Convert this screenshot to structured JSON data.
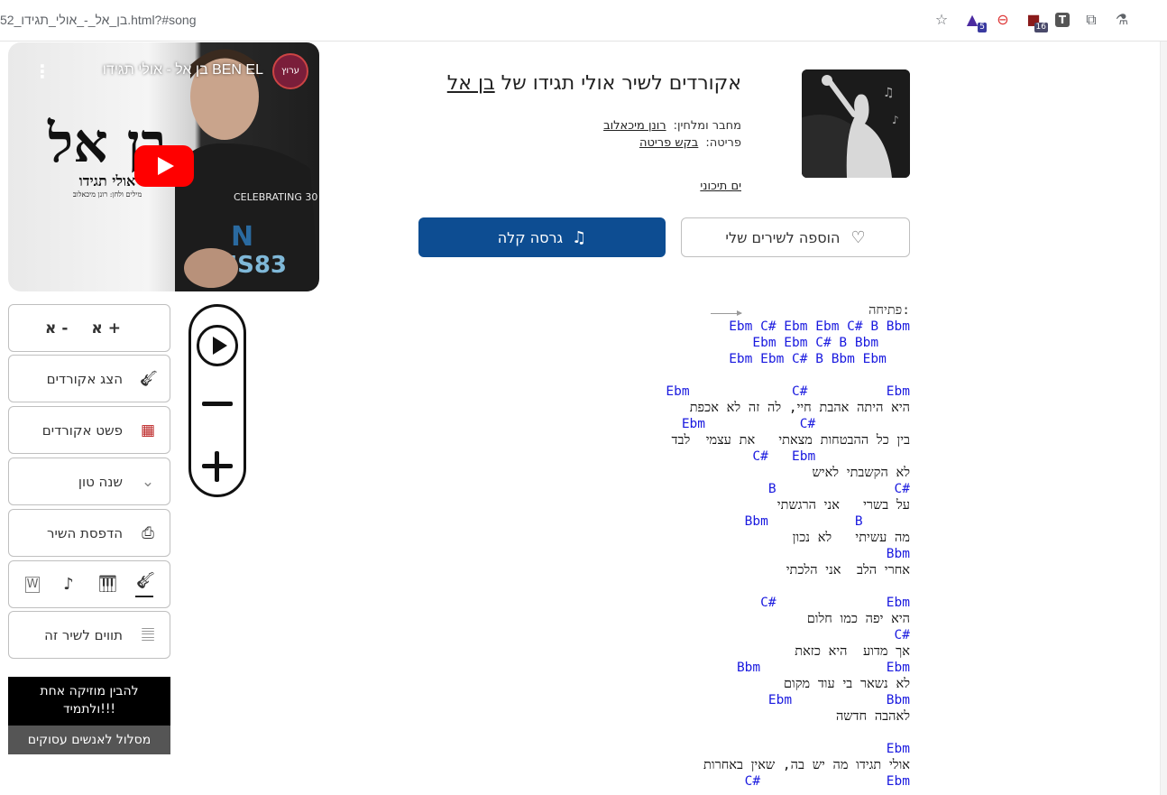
{
  "browser": {
    "url": "52_בן_אל_-_אולי_תגידו.html?#song",
    "extensions": [
      {
        "name": "graduation-cap-icon",
        "badge": "5"
      },
      {
        "name": "cookie-block-icon",
        "badge": ""
      },
      {
        "name": "store-icon",
        "badge": "16"
      },
      {
        "name": "t-square-icon",
        "badge": ""
      },
      {
        "name": "puzzle-icon",
        "badge": ""
      },
      {
        "name": "flask-icon",
        "badge": ""
      }
    ]
  },
  "video": {
    "title": "בן אל - אולי תגידו BEN EL",
    "logo_big": "בן אל",
    "logo_sub": "אולי תגידו",
    "logo_tiny": "מילים ולחן: רונן מיכאלוב",
    "channel": "ערוץ"
  },
  "song": {
    "title_prefix": "אקורדים לשיר אולי תגידו של",
    "artist": "בן אל",
    "composer_label": "מחבר ומלחין:",
    "composer": "רונן מיכאלוב",
    "strum_label": "פריטה:",
    "strum": "בקש פריטה",
    "tag": "ים תיכוני"
  },
  "actions": {
    "add_favorite": "הוספה לשירים שלי",
    "easy_version": "גרסה קלה"
  },
  "tools": {
    "font_plus": "א +",
    "font_minus": "א -",
    "show_chords": "הצג אקורדים",
    "simplify_chords": "פשט אקורדים",
    "change_key": "שנה טון",
    "print_song": "הדפסת השיר",
    "tags_for_song": "תווים לשיר זה"
  },
  "promo": {
    "line1": "להבין מוזיקה אחת",
    "line2": "ולתמיד!!!",
    "cta": "מסלול לאנשים עסוקים"
  },
  "sheet": {
    "intro_label": "פתיחה:",
    "lines": [
      {
        "t": "c",
        "v": "Ebm C# Ebm Ebm C# B Bbm"
      },
      {
        "t": "c",
        "v": "Ebm Ebm C# B Bbm    "
      },
      {
        "t": "c",
        "v": "Ebm Ebm C# B Bbm Ebm   "
      },
      {
        "t": "g",
        "v": ""
      },
      {
        "t": "c",
        "v": "Ebm             C#          Ebm"
      },
      {
        "t": "l",
        "v": "היא היתה אהבת חיי, לה זה לא אכפת"
      },
      {
        "t": "c",
        "v": "Ebm            C#            "
      },
      {
        "t": "l",
        "v": "בין כל ההבטחות מצאתי   את עצמי  לבד"
      },
      {
        "t": "c",
        "v": "C#   Ebm            "
      },
      {
        "t": "l",
        "v": "לא הקשבתי לאיש"
      },
      {
        "t": "c",
        "v": "B               C#"
      },
      {
        "t": "l",
        "v": "על בשרי   אני הרגשתי"
      },
      {
        "t": "c",
        "v": "Bbm           B      "
      },
      {
        "t": "l",
        "v": "מה עשיתי   לא נכון"
      },
      {
        "t": "c",
        "v": "Bbm"
      },
      {
        "t": "l",
        "v": "אחרי הלב  אני הלכתי"
      },
      {
        "t": "g",
        "v": ""
      },
      {
        "t": "c",
        "v": "C#              Ebm"
      },
      {
        "t": "l",
        "v": "היא יפה כמו חלום"
      },
      {
        "t": "c",
        "v": "C#"
      },
      {
        "t": "l",
        "v": "אך מדוע  היא כזאת"
      },
      {
        "t": "c",
        "v": "Bbm                Ebm"
      },
      {
        "t": "l",
        "v": "לא נשאר בי עוד מקום"
      },
      {
        "t": "c",
        "v": "Ebm            Bbm"
      },
      {
        "t": "l",
        "v": "לאהבה חדשה"
      },
      {
        "t": "g",
        "v": ""
      },
      {
        "t": "c",
        "v": "Ebm"
      },
      {
        "t": "l",
        "v": "אולי תגידו מה יש בה, שאין באחרות"
      },
      {
        "t": "c",
        "v": "C#                Ebm"
      }
    ]
  },
  "colors": {
    "chord": "#1a1adf",
    "primary_button": "#0d4d92",
    "youtube_red": "#ff0000"
  }
}
